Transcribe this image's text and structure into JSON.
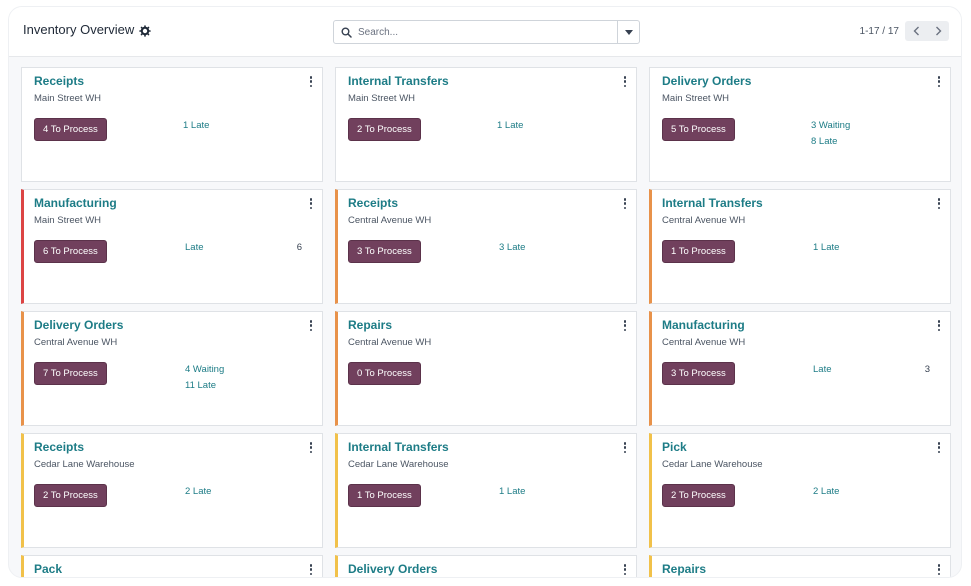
{
  "header": {
    "title": "Inventory Overview",
    "search_placeholder": "Search...",
    "pager": "1-17 / 17"
  },
  "cards": [
    {
      "title": "Receipts",
      "warehouse": "Main Street WH",
      "button": "4 To Process",
      "stats": [
        "1 Late"
      ],
      "count": ""
    },
    {
      "title": "Internal Transfers",
      "warehouse": "Main Street WH",
      "button": "2 To Process",
      "stats": [
        "1 Late"
      ],
      "count": ""
    },
    {
      "title": "Delivery Orders",
      "warehouse": "Main Street WH",
      "button": "5 To Process",
      "stats": [
        "3 Waiting",
        "8 Late"
      ],
      "count": ""
    },
    {
      "title": "Manufacturing",
      "warehouse": "Main Street WH",
      "button": "6 To Process",
      "stats": [
        "Late"
      ],
      "count": "6"
    },
    {
      "title": "Receipts",
      "warehouse": "Central Avenue WH",
      "button": "3 To Process",
      "stats": [
        "3 Late"
      ],
      "count": ""
    },
    {
      "title": "Internal Transfers",
      "warehouse": "Central Avenue WH",
      "button": "1 To Process",
      "stats": [
        "1 Late"
      ],
      "count": ""
    },
    {
      "title": "Delivery Orders",
      "warehouse": "Central Avenue WH",
      "button": "7 To Process",
      "stats": [
        "4 Waiting",
        "11 Late"
      ],
      "count": ""
    },
    {
      "title": "Repairs",
      "warehouse": "Central Avenue WH",
      "button": "0 To Process",
      "stats": [],
      "count": ""
    },
    {
      "title": "Manufacturing",
      "warehouse": "Central Avenue WH",
      "button": "3 To Process",
      "stats": [
        "Late"
      ],
      "count": "3"
    },
    {
      "title": "Receipts",
      "warehouse": "Cedar Lane Warehouse",
      "button": "2 To Process",
      "stats": [
        "2 Late"
      ],
      "count": ""
    },
    {
      "title": "Internal Transfers",
      "warehouse": "Cedar Lane Warehouse",
      "button": "1 To Process",
      "stats": [
        "1 Late"
      ],
      "count": ""
    },
    {
      "title": "Pick",
      "warehouse": "Cedar Lane Warehouse",
      "button": "2 To Process",
      "stats": [
        "2 Late"
      ],
      "count": ""
    },
    {
      "title": "Pack",
      "warehouse": "",
      "button": "",
      "stats": [],
      "count": ""
    },
    {
      "title": "Delivery Orders",
      "warehouse": "",
      "button": "",
      "stats": [],
      "count": ""
    },
    {
      "title": "Repairs",
      "warehouse": "",
      "button": "",
      "stats": [],
      "count": ""
    }
  ],
  "colors": {
    "row_accents": [
      "none",
      "none",
      "none",
      "#dc4444",
      "#e8924a",
      "#e8924a",
      "#e8924a",
      "#e8924a",
      "#e8924a",
      "#f1c14a",
      "#f1c14a",
      "#f1c14a",
      "#f1c14a",
      "#f1c14a",
      "#f1c14a"
    ],
    "title": "#1d7c86",
    "button": "#71405d"
  },
  "icons": {
    "settings": "gear-icon",
    "search": "search-icon",
    "toggle": "caret-down-icon",
    "prev": "chevron-left-icon",
    "next": "chevron-right-icon",
    "menu": "kebab-menu-icon"
  }
}
